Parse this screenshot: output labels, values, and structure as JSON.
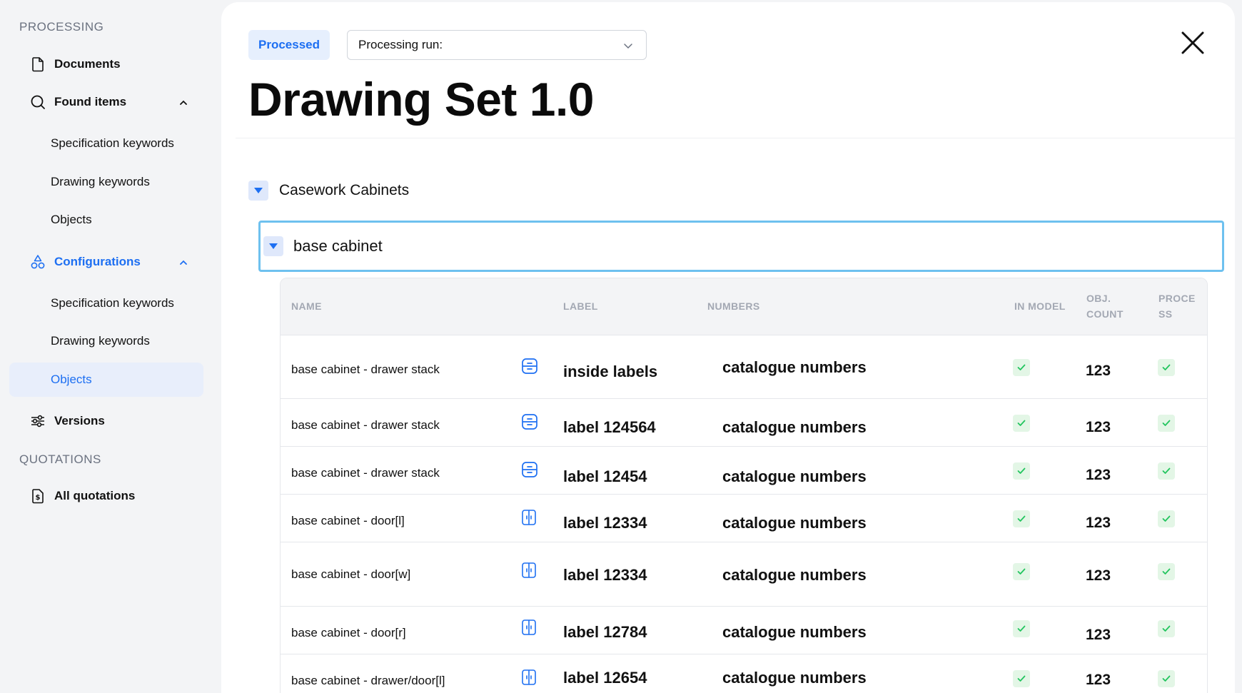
{
  "sidebar": {
    "processing_title": "PROCESSING",
    "documents": "Documents",
    "found_items": "Found items",
    "found_sub": [
      "Specification keywords",
      "Drawing keywords",
      "Objects"
    ],
    "configurations": "Configurations",
    "config_sub": [
      "Specification keywords",
      "Drawing keywords",
      "Objects"
    ],
    "versions": "Versions",
    "quotations_title": "QUOTATIONS",
    "all_quotations": "All quotations"
  },
  "header": {
    "badge": "Processed",
    "run_label": "Processing run:",
    "title": "Drawing Set 1.0"
  },
  "group": {
    "name": "Casework Cabinets"
  },
  "subgroup": {
    "name": "base cabinet"
  },
  "table": {
    "columns": {
      "name": "NAME",
      "label": "LABEL",
      "numbers": "NUMBERS",
      "in_model": "IN MODEL",
      "obj_count_1": "OBJ.",
      "obj_count_2": "COUNT",
      "process_1": "PROCE",
      "process_2": "SS"
    },
    "rows": [
      {
        "name": "base cabinet - drawer stack",
        "icon": "drawer-icon",
        "label": "inside labels",
        "numbers": "catalogue numbers",
        "count": "123"
      },
      {
        "name": "base cabinet - drawer stack",
        "icon": "drawer-icon",
        "label": "label 124564",
        "numbers": "catalogue numbers",
        "count": "123"
      },
      {
        "name": "base cabinet - drawer stack",
        "icon": "drawer-icon",
        "label": "label 12454",
        "numbers": "catalogue numbers",
        "count": "123"
      },
      {
        "name": "base cabinet - door[l]",
        "icon": "door-icon",
        "label": "label 12334",
        "numbers": "catalogue numbers",
        "count": "123"
      },
      {
        "name": "base cabinet - door[w]",
        "icon": "door-icon",
        "label": "label 12334",
        "numbers": "catalogue numbers",
        "count": "123"
      },
      {
        "name": "base cabinet - door[r]",
        "icon": "door-icon",
        "label": "label 12784",
        "numbers": "catalogue numbers",
        "count": "123"
      },
      {
        "name": "base cabinet - drawer/door[l]",
        "icon": "door-icon",
        "label": "label 12654",
        "numbers": "catalogue numbers",
        "count": "123"
      }
    ]
  },
  "colors": {
    "accent": "#1d6ff2",
    "check_bg": "#e3f6e6",
    "check": "#22c55e",
    "focus": "#6ec1ef"
  }
}
